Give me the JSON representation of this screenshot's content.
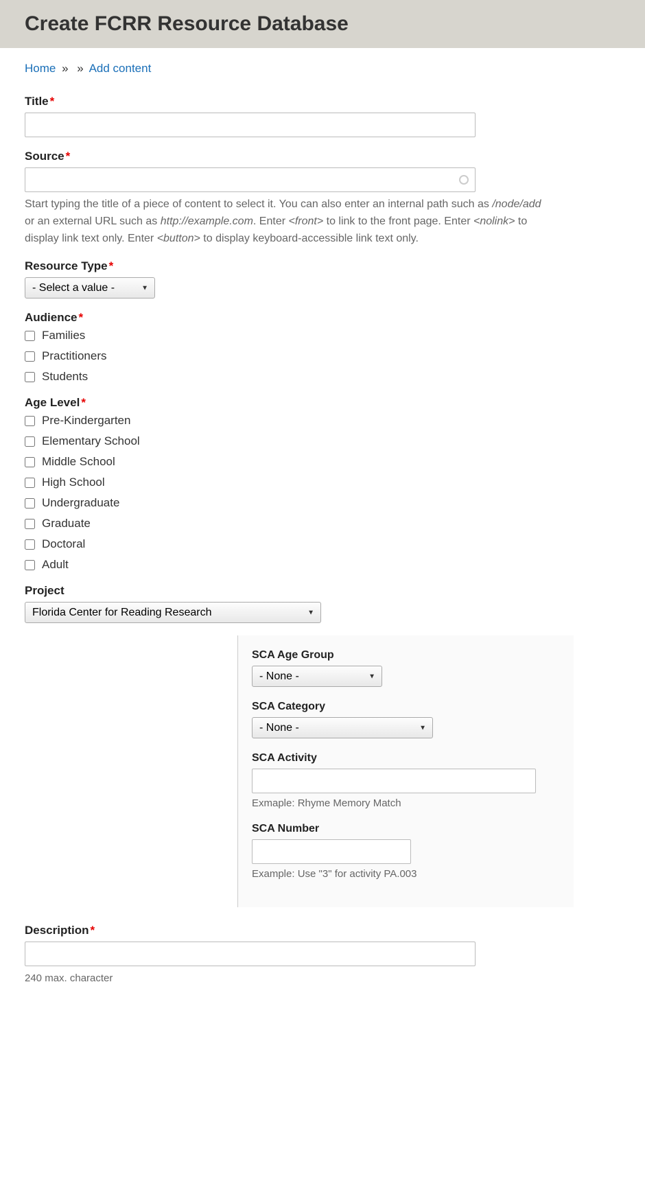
{
  "header": {
    "title": "Create FCRR Resource Database"
  },
  "breadcrumb": {
    "home": "Home",
    "sep": "»",
    "add_content": "Add content"
  },
  "fields": {
    "title": {
      "label": "Title"
    },
    "source": {
      "label": "Source",
      "help_parts": {
        "p1": "Start typing the title of a piece of content to select it. You can also enter an internal path such as ",
        "em1": "/node/add",
        "p2": " or an external URL such as ",
        "em2": "http://example.com",
        "p3": ". Enter ",
        "em3": "<front>",
        "p4": " to link to the front page. Enter ",
        "em4": "<nolink>",
        "p5": " to display link text only. Enter ",
        "em5": "<button>",
        "p6": " to display keyboard-accessible link text only."
      }
    },
    "resource_type": {
      "label": "Resource Type",
      "selected": "- Select a value -"
    },
    "audience": {
      "label": "Audience",
      "options": [
        "Families",
        "Practitioners",
        "Students"
      ]
    },
    "age_level": {
      "label": "Age Level",
      "options": [
        "Pre-Kindergarten",
        "Elementary School",
        "Middle School",
        "High School",
        "Undergraduate",
        "Graduate",
        "Doctoral",
        "Adult"
      ]
    },
    "project": {
      "label": "Project",
      "selected": "Florida Center for Reading Research"
    },
    "sca_age_group": {
      "label": "SCA Age Group",
      "selected": "- None -"
    },
    "sca_category": {
      "label": "SCA Category",
      "selected": "- None -"
    },
    "sca_activity": {
      "label": "SCA Activity",
      "help": "Exmaple: Rhyme Memory Match"
    },
    "sca_number": {
      "label": "SCA Number",
      "help": "Example: Use \"3\" for activity PA.003"
    },
    "description": {
      "label": "Description",
      "help": "240 max. character"
    }
  }
}
